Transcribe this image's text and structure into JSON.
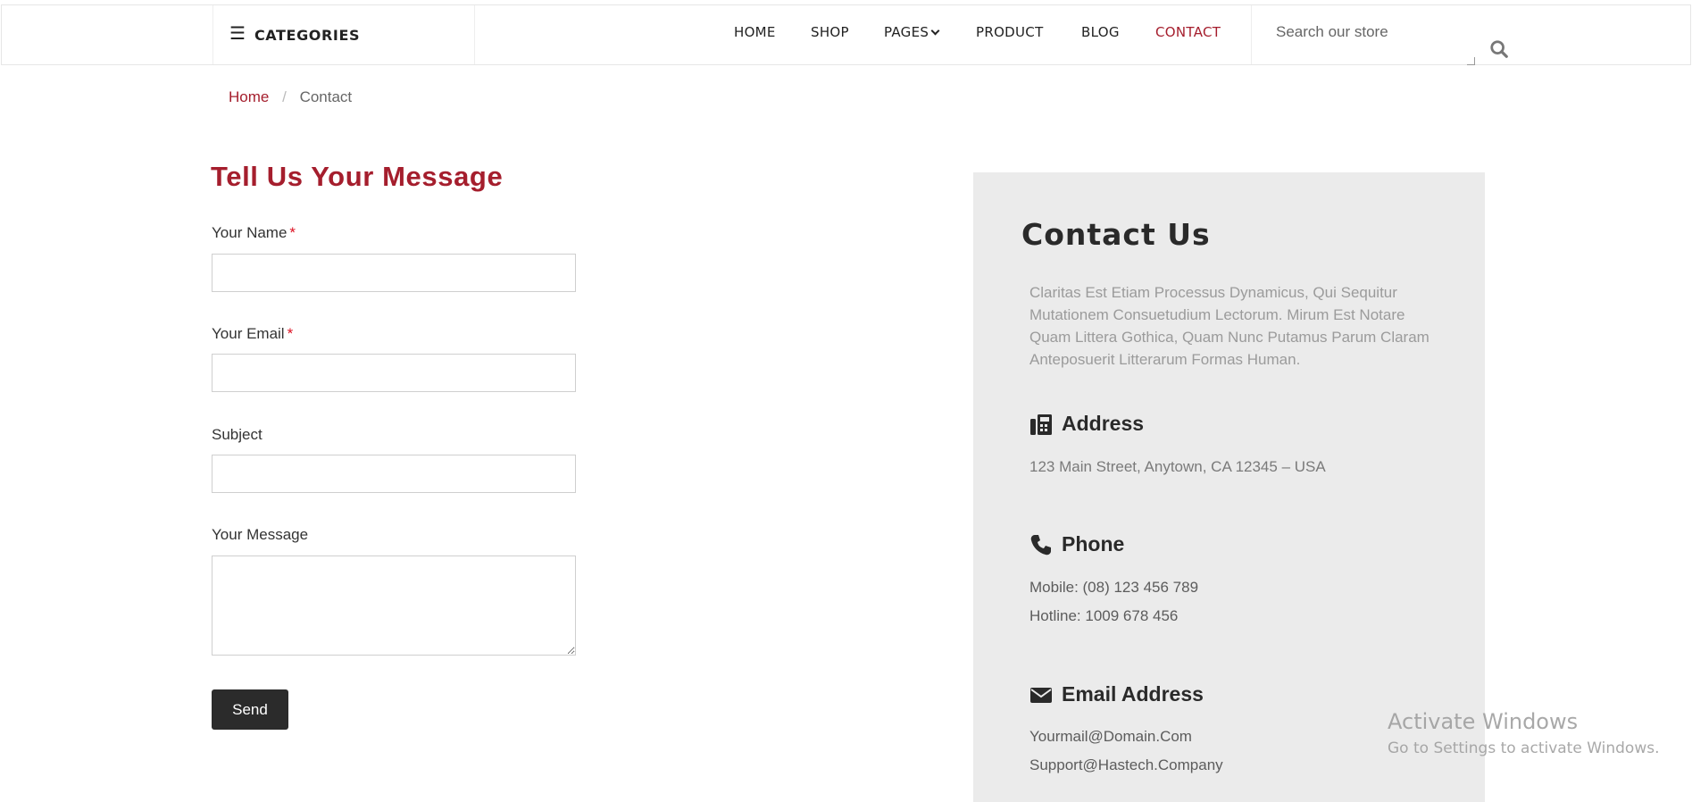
{
  "header": {
    "categories_label": "CATEGORIES",
    "categories_icon": "hamburger-menu-icon",
    "nav": {
      "home": "HOME",
      "shop": "SHOP",
      "pages": "PAGES",
      "product": "PRODUCT",
      "blog": "BLOG",
      "contact": "CONTACT"
    },
    "active_nav": "CONTACT",
    "search": {
      "placeholder": "Search our store",
      "icon": "search-icon"
    }
  },
  "breadcrumb": {
    "home": "Home",
    "separator": "/",
    "current": "Contact"
  },
  "form": {
    "title": "Tell Us Your Message",
    "name_label": "Your Name",
    "email_label": "Your Email",
    "subject_label": "Subject",
    "message_label": "Your Message",
    "required_marker": "*",
    "send_label": "Send"
  },
  "contact": {
    "title": "Contact Us",
    "intro": "Claritas Est Etiam Processus Dynamicus, Qui Sequitur Mutationem Consuetudium Lectorum. Mirum Est Notare Quam Littera Gothica, Quam Nunc Putamus Parum Claram Anteposuerit Litterarum Formas Human.",
    "address": {
      "heading": "Address",
      "icon": "fax-building-icon",
      "line": "123 Main Street, Anytown, CA 12345 – USA"
    },
    "phone": {
      "heading": "Phone",
      "icon": "phone-icon",
      "mobile": "Mobile: (08) 123 456 789",
      "hotline": "Hotline: 1009 678 456"
    },
    "email": {
      "heading": "Email Address",
      "icon": "envelope-icon",
      "primary": "Yourmail@Domain.Com",
      "support": "Support@Hastech.Company"
    }
  },
  "watermark": {
    "title": "Activate Windows",
    "subtitle": "Go to Settings to activate Windows."
  },
  "colors": {
    "accent": "#a51e2d",
    "panel_bg": "#ebebeb",
    "button_bg": "#2b2b2b"
  }
}
